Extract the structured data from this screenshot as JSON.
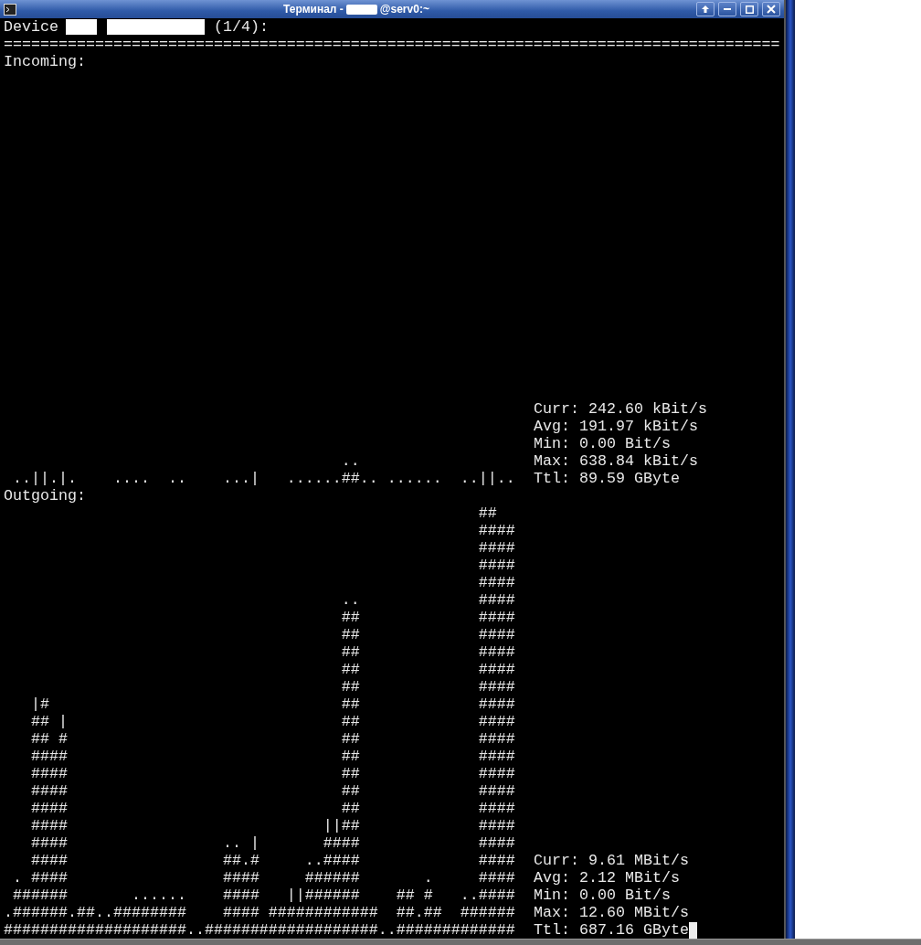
{
  "window": {
    "title_start": "Терминал -",
    "title_end": "@serv0:~",
    "title_buttons": [
      {
        "kind": "raise"
      },
      {
        "kind": "minimize"
      },
      {
        "kind": "maximize"
      },
      {
        "kind": "close"
      }
    ]
  },
  "terminal": {
    "header": {
      "label": "Device",
      "counter": "(1/4):"
    },
    "separator": "=====================================================================================",
    "sections": [
      {
        "heading": "Incoming:",
        "graph": [
          "                                     ..",
          " ..||.|.    ....  ..    ...|   ......##.. ......  ..||.."
        ],
        "stats": [
          "Curr: 242.60 kBit/s",
          "Avg: 191.97 kBit/s",
          "Min: 0.00 Bit/s",
          "Max: 638.84 kBit/s",
          "Ttl: 89.59 GByte"
        ],
        "cursor": false
      },
      {
        "heading": "Outgoing:",
        "graph": [
          "                                                    ##",
          "                                                    ####",
          "                                                    ####",
          "                                                    ####",
          "                                                    ####",
          "                                     ..             ####",
          "                                     ##             ####",
          "                                     ##             ####",
          "                                     ##             ####",
          "                                     ##             ####",
          "                                     ##             ####",
          "   |#                                ##             ####",
          "   ## |                              ##             ####",
          "   ## #                              ##             ####",
          "   ####                              ##             ####",
          "   ####                              ##             ####",
          "   ####                              ##             ####",
          "   ####                              ##             ####",
          "   ####                            ||##             ####",
          "   ####                 .. |       ####             ####",
          "   ####                 ##.#     ..####             ####",
          " . ####                 ####     ######       .     ####",
          " ######       ......    ####   ||######    ## #   ..####",
          ".######.##..########    #### ############  ##.##  ######",
          "####################..###################..#############"
        ],
        "stats": [
          "Curr: 9.61 MBit/s",
          "Avg: 2.12 MBit/s",
          "Min: 0.00 Bit/s",
          "Max: 12.60 MBit/s",
          "Ttl: 687.16 GByte"
        ],
        "cursor": true
      }
    ]
  }
}
